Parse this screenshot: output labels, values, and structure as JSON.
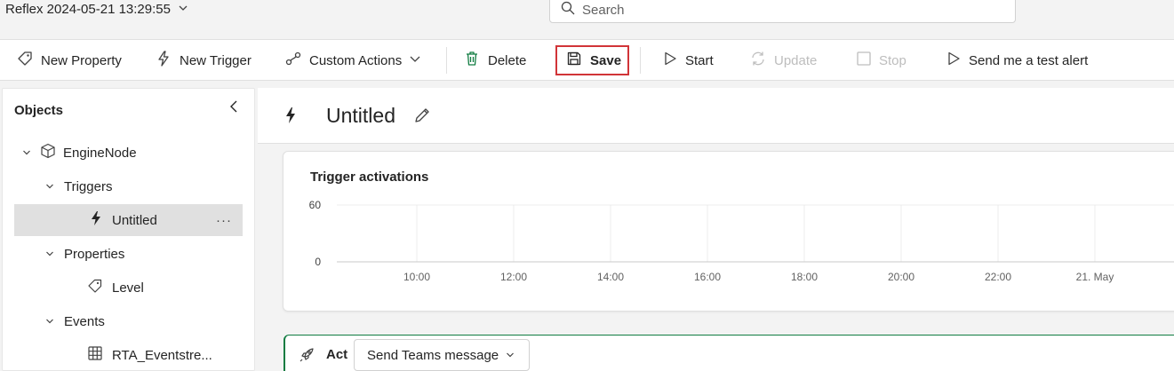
{
  "app": {
    "title": "Reflex 2024-05-21 13:29:55"
  },
  "search": {
    "placeholder": "Search"
  },
  "toolbar": {
    "new_property": "New Property",
    "new_trigger": "New Trigger",
    "custom_actions": "Custom Actions",
    "delete": "Delete",
    "save": "Save",
    "start": "Start",
    "update": "Update",
    "stop": "Stop",
    "test_alert": "Send me a test alert"
  },
  "objects": {
    "title": "Objects",
    "node": "EngineNode",
    "triggers_label": "Triggers",
    "trigger_item": "Untitled",
    "more": "···",
    "properties_label": "Properties",
    "property_item": "Level",
    "events_label": "Events",
    "event_item": "RTA_Eventstre..."
  },
  "main": {
    "title": "Untitled"
  },
  "chart_data": {
    "type": "line",
    "title": "Trigger activations",
    "x_ticks": [
      "10:00",
      "12:00",
      "14:00",
      "16:00",
      "18:00",
      "20:00",
      "22:00",
      "21. May"
    ],
    "y_ticks": [
      "60",
      "0"
    ],
    "ylim": [
      0,
      60
    ],
    "grid": true,
    "series": []
  },
  "act": {
    "label": "Act",
    "selected_action": "Send Teams message"
  },
  "colors": {
    "highlight": "#d13438",
    "accent": "#107c41"
  }
}
